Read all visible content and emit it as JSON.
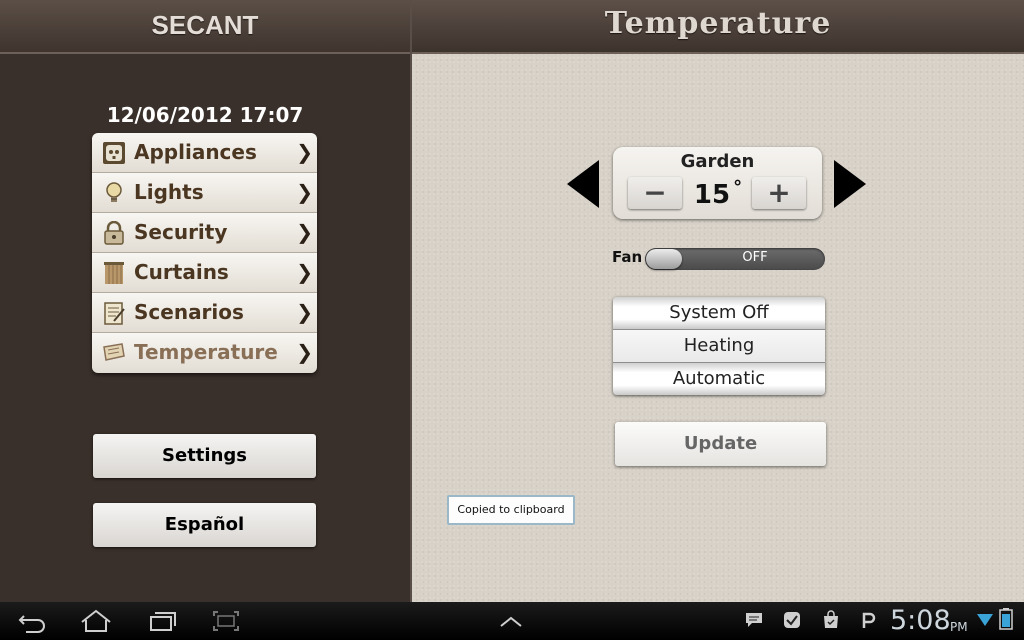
{
  "app": {
    "brand": "SECANT",
    "datetime": "12/06/2012 17:07"
  },
  "menu": {
    "items": [
      {
        "label": "Appliances",
        "icon": "socket-icon"
      },
      {
        "label": "Lights",
        "icon": "lightbulb-icon"
      },
      {
        "label": "Security",
        "icon": "lock-icon"
      },
      {
        "label": "Curtains",
        "icon": "curtains-icon"
      },
      {
        "label": "Scenarios",
        "icon": "scenario-icon"
      },
      {
        "label": "Temperature",
        "icon": "thermostat-icon",
        "active": true
      }
    ],
    "chevron": "❯"
  },
  "buttons": {
    "settings": "Settings",
    "language": "Español"
  },
  "page": {
    "title": "Temperature"
  },
  "zone": {
    "name": "Garden",
    "temperature": "15",
    "degree_symbol": "°",
    "minus": "−",
    "plus": "+"
  },
  "fan": {
    "label": "Fan",
    "state": "OFF"
  },
  "modes": {
    "items": [
      "System Off",
      "Heating",
      "Automatic"
    ],
    "selected": "Heating"
  },
  "update": {
    "label": "Update"
  },
  "toast": {
    "text": "Copied to clipboard"
  },
  "statusbar": {
    "time": "5:08",
    "ampm": "PM"
  },
  "colors": {
    "accent_text": "#4b3621",
    "active_text": "#8a6f57",
    "panel_dark": "#3a302b"
  }
}
